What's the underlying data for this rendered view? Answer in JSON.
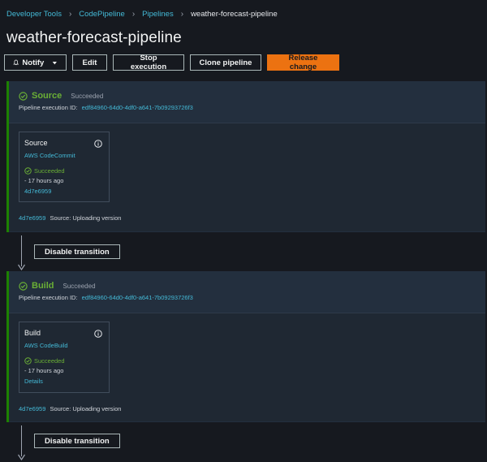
{
  "breadcrumb": {
    "items": [
      "Developer Tools",
      "CodePipeline",
      "Pipelines"
    ],
    "current": "weather-forecast-pipeline"
  },
  "page_title": "weather-forecast-pipeline",
  "toolbar": {
    "notify": "Notify",
    "edit": "Edit",
    "stop": "Stop execution",
    "clone": "Clone pipeline",
    "release": "Release change"
  },
  "stages": [
    {
      "name": "Source",
      "status": "Succeeded",
      "exec_label": "Pipeline execution ID:",
      "exec_id": "edf84960-64d0-4df0-a641-7b09293726f3",
      "action": {
        "name": "Source",
        "provider": "AWS CodeCommit",
        "status": "Succeeded",
        "time": "- 17 hours ago",
        "link": "4d7e6959"
      },
      "revision_id": "4d7e6959",
      "revision_text": "Source: Uploading version"
    },
    {
      "name": "Build",
      "status": "Succeeded",
      "exec_label": "Pipeline execution ID:",
      "exec_id": "edf84960-64d0-4df0-a641-7b09293726f3",
      "action": {
        "name": "Build",
        "provider": "AWS CodeBuild",
        "status": "Succeeded",
        "time": "- 17 hours ago",
        "link": "Details"
      },
      "revision_id": "4d7e6959",
      "revision_text": "Source: Uploading version"
    }
  ],
  "transitions": [
    {
      "label": "Disable transition"
    },
    {
      "label": "Disable transition"
    }
  ],
  "colors": {
    "success": "#6aaf35",
    "link": "#44b9d6",
    "primary_button": "#ec7211",
    "background": "#16191f",
    "stage_background": "#232f3e"
  },
  "icons": {
    "notify": "bell-icon",
    "dropdown": "caret-down-icon",
    "success": "check-circle-icon",
    "info": "info-icon",
    "transition": "arrow-down-icon"
  }
}
